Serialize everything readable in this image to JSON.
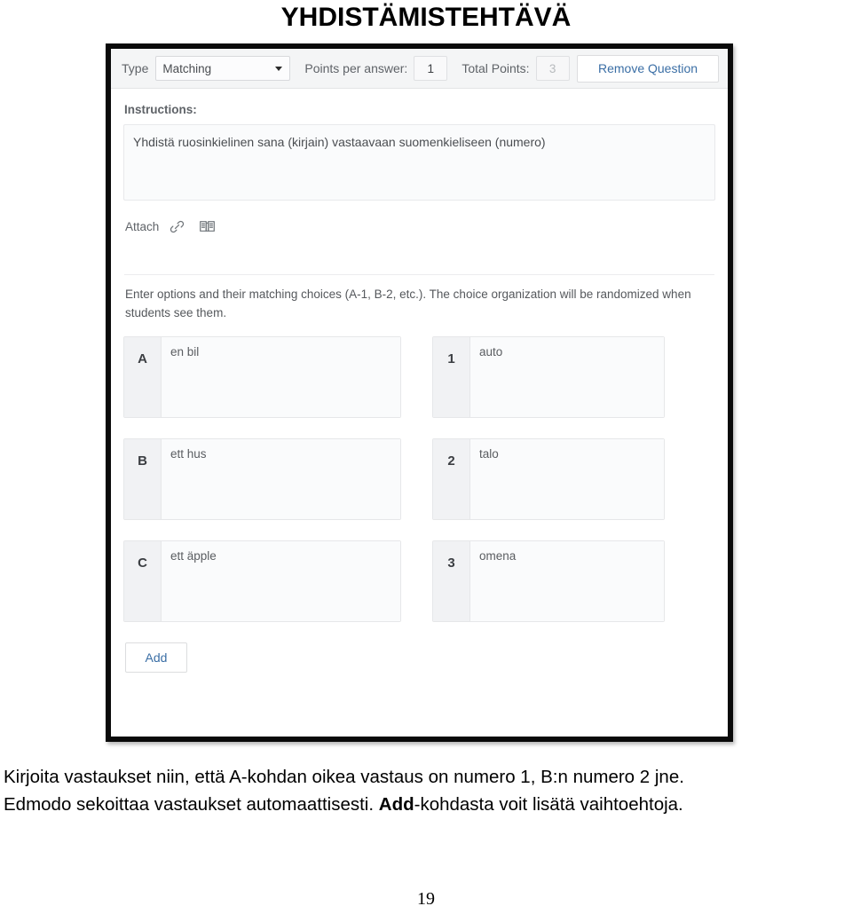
{
  "document": {
    "title": "YHDISTÄMISTEHTÄVÄ",
    "page_number": "19",
    "caption_line1": "Kirjoita vastaukset niin, että A-kohdan oikea vastaus on numero 1, B:n numero 2 jne.",
    "caption_line2_before": "Edmodo sekoittaa vastaukset automaattisesti. ",
    "caption_line2_bold": "Add",
    "caption_line2_after": "-kohdasta voit lisätä vaihtoehtoja."
  },
  "screenshot": {
    "toolbar": {
      "type_label": "Type",
      "type_value": "Matching",
      "points_per_answer_label": "Points per answer:",
      "points_per_answer_value": "1",
      "total_points_label": "Total Points:",
      "total_points_value": "3",
      "remove_question_label": "Remove Question"
    },
    "instructions": {
      "label": "Instructions:",
      "value": "Yhdistä ruosinkielinen sana (kirjain) vastaavaan suomenkieliseen (numero)"
    },
    "attach": {
      "label": "Attach",
      "icons": [
        "link-icon",
        "library-icon"
      ]
    },
    "hint": "Enter options and their matching choices (A-1, B-2, etc.). The choice organization will be randomized when students see them.",
    "pairs": [
      {
        "option_key": "A",
        "option_value": "en bil",
        "choice_key": "1",
        "choice_value": "auto"
      },
      {
        "option_key": "B",
        "option_value": "ett hus",
        "choice_key": "2",
        "choice_value": "talo"
      },
      {
        "option_key": "C",
        "option_value": "ett äpple",
        "choice_key": "3",
        "choice_value": "omena"
      }
    ],
    "add_label": "Add",
    "colors": {
      "link_blue": "#3a6ea5",
      "toolbar_bg": "#f4f5f6",
      "cell_bg": "#f7f8f9"
    }
  }
}
